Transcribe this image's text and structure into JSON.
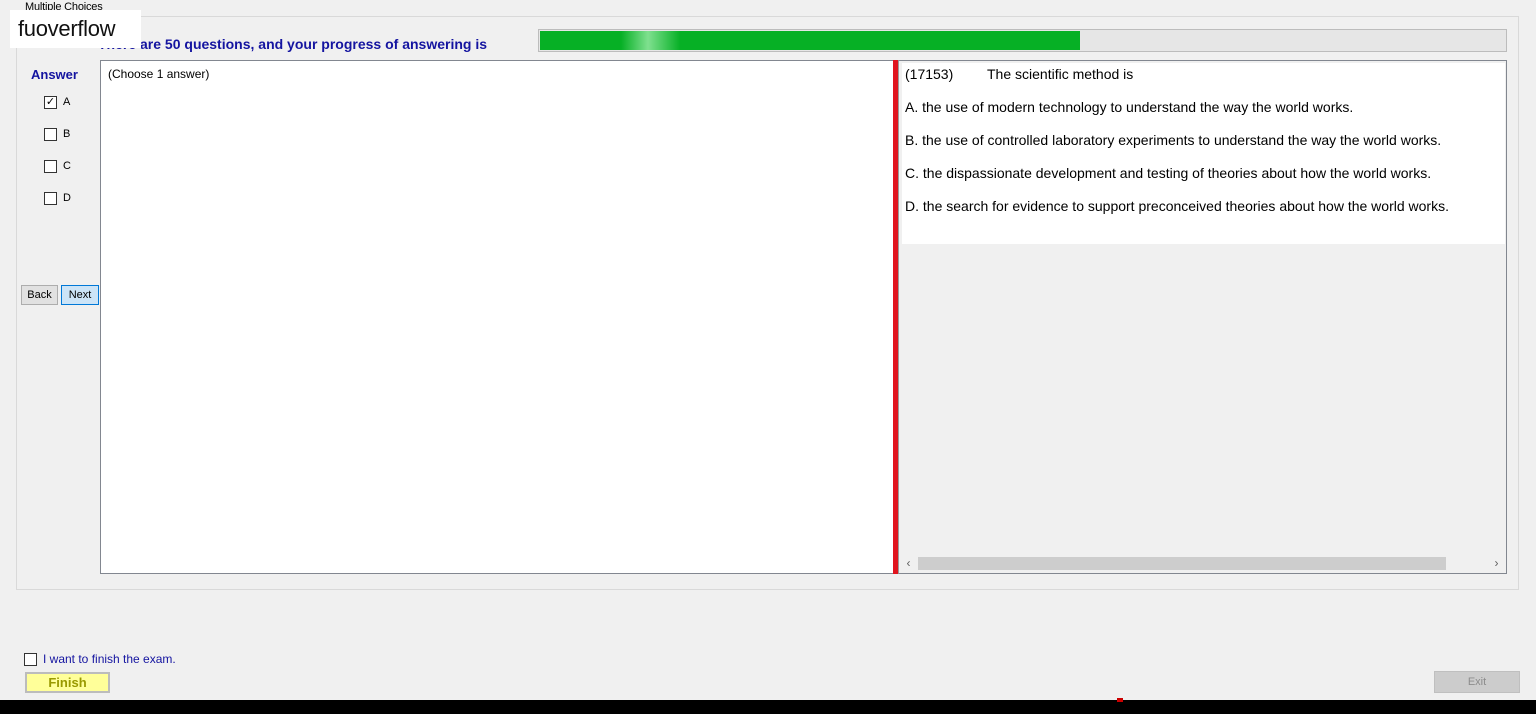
{
  "window": {
    "group_title": "Multiple Choices",
    "watermark": "fuoverflow"
  },
  "progress": {
    "label": "There are 50 questions, and your progress of answering is",
    "fraction": 0.56,
    "color": "#06b025"
  },
  "answer_panel": {
    "title": "Answer",
    "options": [
      {
        "label": "A",
        "checked": true
      },
      {
        "label": "B",
        "checked": false
      },
      {
        "label": "C",
        "checked": false
      },
      {
        "label": "D",
        "checked": false
      }
    ],
    "back_label": "Back",
    "next_label": "Next"
  },
  "left_pane": {
    "hint": "(Choose 1 answer)"
  },
  "question": {
    "id": "(17153)",
    "text": "The scientific method is",
    "options": [
      "A.  the use of modern technology to understand the way the world works.",
      "B.  the use of controlled laboratory experiments to understand the way the world works.",
      "C.  the dispassionate development and testing of theories about how the world works.",
      "D.  the search for evidence to support preconceived theories about how the world works."
    ]
  },
  "footer": {
    "finish_checkbox_label": "I want to finish the exam.",
    "finish_checked": false,
    "finish_label": "Finish",
    "exit_label": "Exit"
  },
  "icons": {
    "checkmark": "check-icon",
    "scroll_left": "chevron-left-icon",
    "scroll_right": "chevron-right-icon"
  }
}
